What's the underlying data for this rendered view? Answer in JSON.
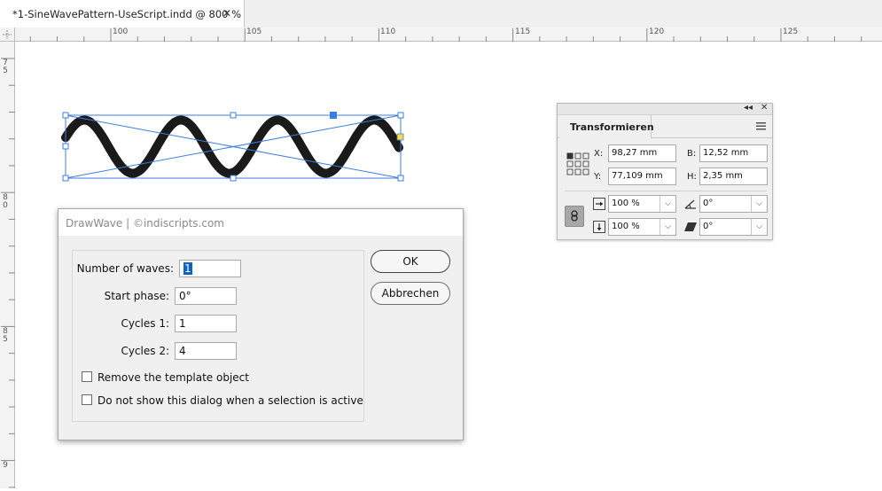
{
  "tab": {
    "title": "*1-SineWavePattern-UseScript.indd @ 800 %",
    "close": "✕"
  },
  "ruler": {
    "h_labels": [
      "100",
      "105",
      "110",
      "115",
      "120",
      "125"
    ],
    "v_labels": [
      [
        "7",
        "5"
      ],
      [
        "8",
        "0"
      ],
      [
        "8",
        "5"
      ],
      [
        "9"
      ]
    ]
  },
  "dialog": {
    "title": "DrawWave  |  ©indiscripts.com",
    "fields": {
      "waves": {
        "label": "Number of waves:",
        "value": "1"
      },
      "phase": {
        "label": "Start phase:",
        "value": "0°"
      },
      "cycles1": {
        "label": "Cycles 1:",
        "value": "1"
      },
      "cycles2": {
        "label": "Cycles 2:",
        "value": "4"
      }
    },
    "checkboxes": {
      "remove": "Remove the template object",
      "noshow": "Do not show this dialog when a selection is active"
    },
    "ok": "OK",
    "cancel": "Abbrechen"
  },
  "transform": {
    "tab": "Transformieren",
    "x": {
      "label": "X:",
      "value": "98,27 mm"
    },
    "y": {
      "label": "Y:",
      "value": "77,109 mm"
    },
    "b": {
      "label": "B:",
      "value": "12,52 mm"
    },
    "h": {
      "label": "H:",
      "value": "2,35 mm"
    },
    "scale_x": "100 %",
    "scale_y": "100 %",
    "rotate": "0°",
    "shear": "0°",
    "collapse": "◂◂",
    "close": "✕",
    "dropdown": "⌵"
  }
}
